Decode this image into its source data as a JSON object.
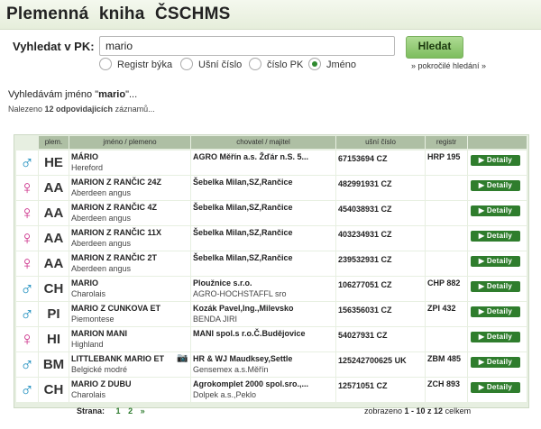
{
  "header": {
    "title": "Plemenná kniha ČSCHMS"
  },
  "search": {
    "label": "Vyhledat v PK:",
    "value": "mario",
    "button": "Hledat",
    "options": [
      {
        "label": "Registr býka",
        "selected": false
      },
      {
        "label": "Ušní číslo",
        "selected": false
      },
      {
        "label": "číslo PK",
        "selected": false
      },
      {
        "label": "Jméno",
        "selected": true
      }
    ],
    "advanced": "» pokročilé hledání »"
  },
  "status": {
    "searching_prefix": "Vyhledávám jméno \"",
    "searching_term": "mario",
    "searching_suffix": "\"...",
    "found_prefix": "Nalezeno ",
    "found_count": "12 odpovidajicích",
    "found_suffix": " záznamů..."
  },
  "table": {
    "headers": {
      "breed": "plem.",
      "name": "jméno / plemeno",
      "owner": "chovatel / majitel",
      "ear": "ušní číslo",
      "registry": "registr"
    },
    "detail_label": "▶ Detaily",
    "rows": [
      {
        "sex": "male",
        "symbol": "♂",
        "breed": "HE",
        "name": "MÁRIO",
        "breed_name": "Hereford",
        "owner": "AGRO Měřín a.s. Žďár n.S. 5...",
        "owner2": "",
        "ear": "67153694 CZ",
        "registry": "HRP 195",
        "photo": false
      },
      {
        "sex": "female",
        "symbol": "♀",
        "breed": "AA",
        "name": "MARION Z RANČIC 24Z",
        "breed_name": "Aberdeen angus",
        "owner": "Šebelka Milan,SZ,Rančice",
        "owner2": "",
        "ear": "482991931 CZ",
        "registry": "",
        "photo": false
      },
      {
        "sex": "female",
        "symbol": "♀",
        "breed": "AA",
        "name": "MARION Z RANČIC 4Z",
        "breed_name": "Aberdeen angus",
        "owner": "Šebelka Milan,SZ,Rančice",
        "owner2": "",
        "ear": "454038931 CZ",
        "registry": "",
        "photo": false
      },
      {
        "sex": "female",
        "symbol": "♀",
        "breed": "AA",
        "name": "MARION Z RANČIC 11X",
        "breed_name": "Aberdeen angus",
        "owner": "Šebelka Milan,SZ,Rančice",
        "owner2": "",
        "ear": "403234931 CZ",
        "registry": "",
        "photo": false
      },
      {
        "sex": "female",
        "symbol": "♀",
        "breed": "AA",
        "name": "MARION Z RANČIC 2T",
        "breed_name": "Aberdeen angus",
        "owner": "Šebelka Milan,SZ,Rančice",
        "owner2": "",
        "ear": "239532931 CZ",
        "registry": "",
        "photo": false
      },
      {
        "sex": "male",
        "symbol": "♂",
        "breed": "CH",
        "name": "MARIO",
        "breed_name": "Charolais",
        "owner": "Ploužnice s.r.o.",
        "owner2": "AGRO-HOCHSTAFFL sro",
        "ear": "106277051 CZ",
        "registry": "CHP 882",
        "photo": false
      },
      {
        "sex": "male",
        "symbol": "♂",
        "breed": "PI",
        "name": "MARIO Z CUNKOVA ET",
        "breed_name": "Piemontese",
        "owner": "Kozák Pavel,Ing.,Milevsko",
        "owner2": "BENDA JIRI",
        "ear": "156356031 CZ",
        "registry": "ZPI 432",
        "photo": false
      },
      {
        "sex": "female",
        "symbol": "♀",
        "breed": "HI",
        "name": "MARION MANI",
        "breed_name": "Highland",
        "owner": "MANI spol.s r.o.Č.Budějovice",
        "owner2": "",
        "ear": "54027931 CZ",
        "registry": "",
        "photo": false
      },
      {
        "sex": "male",
        "symbol": "♂",
        "breed": "BM",
        "name": "LITTLEBANK MARIO ET",
        "breed_name": "Belgické modré",
        "owner": "HR & WJ Maudksey,Settle",
        "owner2": "Gensemex a.s.Měřín",
        "ear": "125242700625 UK",
        "registry": "ZBM 485",
        "photo": true
      },
      {
        "sex": "male",
        "symbol": "♂",
        "breed": "CH",
        "name": "MARIO Z DUBU",
        "breed_name": "Charolais",
        "owner": "Agrokomplet 2000 spol.sro.,...",
        "owner2": "Dolpek a.s.,Peklo",
        "ear": "12571051 CZ",
        "registry": "ZCH 893",
        "photo": false
      }
    ]
  },
  "pager": {
    "label": "Strana:",
    "pages": [
      "1",
      "2",
      "»"
    ],
    "summary_prefix": "zobrazeno ",
    "summary_range": "1 - 10 z 12",
    "summary_suffix": " celkem"
  }
}
